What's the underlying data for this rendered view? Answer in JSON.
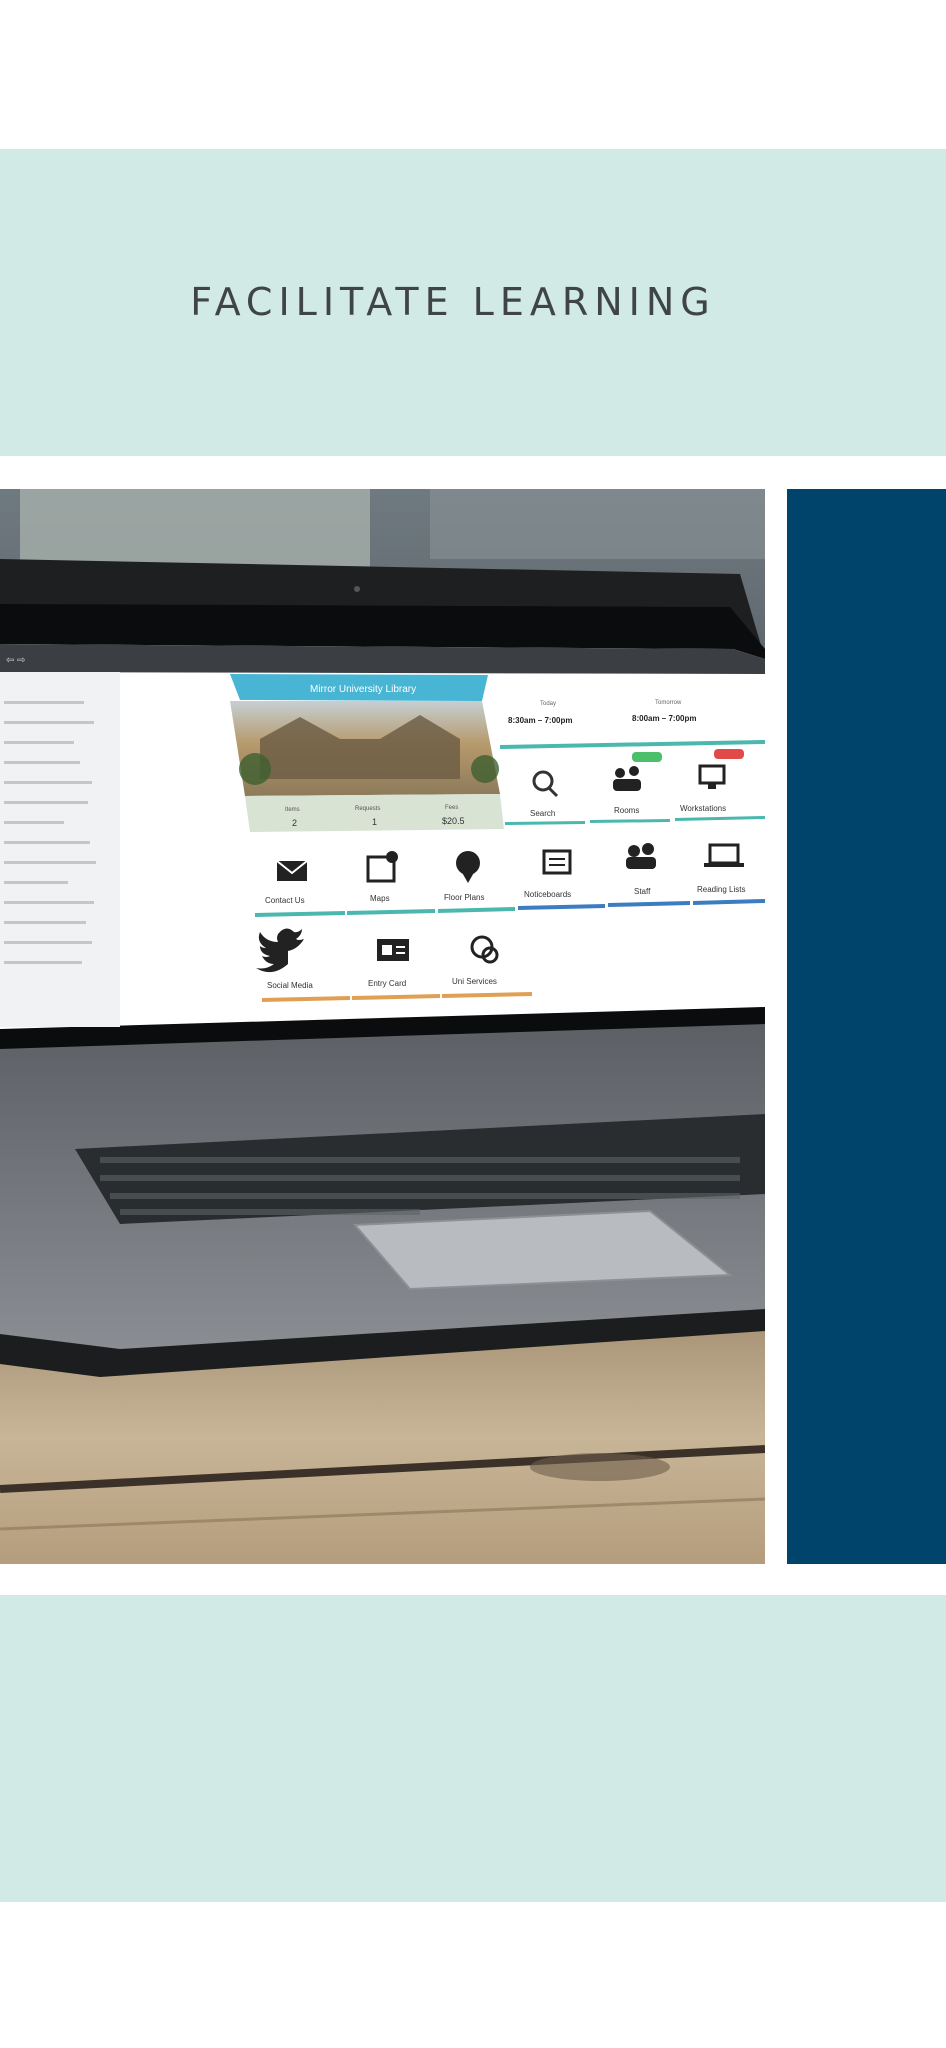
{
  "headline": "FACILITATE LEARNING",
  "photo": {
    "screen_app": {
      "banner_title": "Mirror University Library",
      "hours_1_label": "Today",
      "hours_1_value": "8:30am – 7:00pm",
      "hours_2_label": "Tomorrow",
      "hours_2_value": "8:00am – 7:00pm",
      "stats": [
        {
          "label": "Items",
          "value": "2"
        },
        {
          "label": "Requests",
          "value": "1"
        },
        {
          "label": "Fees",
          "value": "$20.5"
        }
      ],
      "tiles": [
        {
          "label": "Search",
          "icon": "search-icon"
        },
        {
          "label": "Rooms",
          "icon": "people-icon"
        },
        {
          "label": "Workstations",
          "icon": "monitor-icon"
        },
        {
          "label": "Contact Us",
          "icon": "mail-icon"
        },
        {
          "label": "Maps",
          "icon": "map-icon"
        },
        {
          "label": "Floor Plans",
          "icon": "location-icon"
        },
        {
          "label": "Noticeboards",
          "icon": "board-icon"
        },
        {
          "label": "Staff",
          "icon": "staff-icon"
        },
        {
          "label": "Reading Lists",
          "icon": "laptop-icon"
        },
        {
          "label": "Social Media",
          "icon": "twitter-icon"
        },
        {
          "label": "Entry Card",
          "icon": "id-card-icon"
        },
        {
          "label": "Uni Services",
          "icon": "services-icon"
        }
      ]
    }
  },
  "colors": {
    "band": "#d1eae5",
    "panel": "#00436b",
    "headline": "#3f4545",
    "tile_teal": "#4bb8b0",
    "tile_blue": "#3c7cc0",
    "tile_orange": "#e0a054"
  }
}
